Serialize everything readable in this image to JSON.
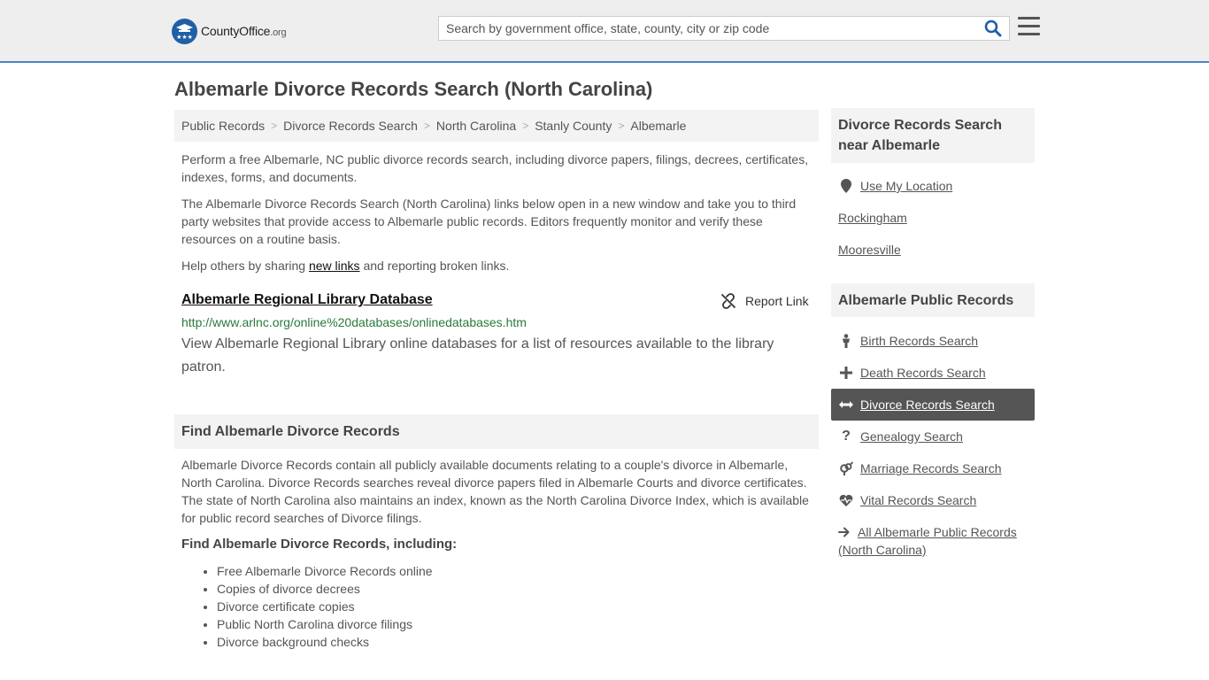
{
  "header": {
    "logo_name": "CountyOffice",
    "logo_tld": ".org",
    "search_placeholder": "Search by government office, state, county, city or zip code"
  },
  "page_title": "Albemarle Divorce Records Search (North Carolina)",
  "breadcrumb": [
    "Public Records",
    "Divorce Records Search",
    "North Carolina",
    "Stanly County",
    "Albemarle"
  ],
  "intro": {
    "p1": "Perform a free Albemarle, NC public divorce records search, including divorce papers, filings, decrees, certificates, indexes, forms, and documents.",
    "p2": "The Albemarle Divorce Records Search (North Carolina) links below open in a new window and take you to third party websites that provide access to Albemarle public records. Editors frequently monitor and verify these resources on a routine basis.",
    "p3_before": "Help others by sharing ",
    "p3_link": "new links",
    "p3_after": " and reporting broken links."
  },
  "listing": {
    "title": "Albemarle Regional Library Database",
    "report_label": "Report Link",
    "url": "http://www.arlnc.org/online%20databases/onlinedatabases.htm",
    "description": "View Albemarle Regional Library online databases for a list of resources available to the library patron."
  },
  "find_section": {
    "heading": "Find Albemarle Divorce Records",
    "body": "Albemarle Divorce Records contain all publicly available documents relating to a couple's divorce in Albemarle, North Carolina. Divorce Records searches reveal divorce papers filed in Albemarle Courts and divorce certificates. The state of North Carolina also maintains an index, known as the North Carolina Divorce Index, which is available for public record searches of Divorce filings.",
    "subheading": "Find Albemarle Divorce Records, including:",
    "items": [
      "Free Albemarle Divorce Records online",
      "Copies of divorce decrees",
      "Divorce certificate copies",
      "Public North Carolina divorce filings",
      "Divorce background checks"
    ]
  },
  "sidebar": {
    "nearby_heading": "Divorce Records Search near Albemarle",
    "use_location": "Use My Location",
    "nearby": [
      "Rockingham",
      "Mooresville"
    ],
    "public_heading": "Albemarle Public Records",
    "records": [
      {
        "label": "Birth Records Search",
        "icon": "person-icon"
      },
      {
        "label": "Death Records Search",
        "icon": "cross-icon"
      },
      {
        "label": "Divorce Records Search",
        "icon": "arrows-horizontal-icon"
      },
      {
        "label": "Genealogy Search",
        "icon": "question-icon"
      },
      {
        "label": "Marriage Records Search",
        "icon": "gender-icon"
      },
      {
        "label": "Vital Records Search",
        "icon": "heartbeat-icon"
      }
    ],
    "all_records": "All Albemarle Public Records (North Carolina)"
  },
  "colors": {
    "accent": "#4a86c5",
    "logo_blue": "#1f5fa6",
    "url_green": "#2a7a3a",
    "active_bg": "#555555"
  }
}
